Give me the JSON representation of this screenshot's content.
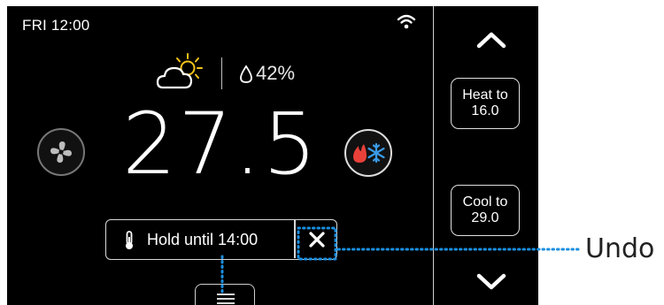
{
  "status": {
    "day_time": "FRI  12:00",
    "wifi_icon": "wifi-icon"
  },
  "weather": {
    "icon": "partly-sunny-icon",
    "humidity_icon": "droplet-icon",
    "humidity": "42%"
  },
  "current_temp": "27.5",
  "fan_button_icon": "fan-icon",
  "mode_button_icon": "heat-cool-mode-icon",
  "hold": {
    "icon": "thermometer-icon",
    "label": "Hold until 14:00",
    "close_icon": "close-icon"
  },
  "bottom_tab_icon": "menu-icon",
  "setpoints": {
    "up_icon": "chevron-up-icon",
    "heat": {
      "line1": "Heat to",
      "line2": "16.0"
    },
    "cool": {
      "line1": "Cool to",
      "line2": "29.0"
    },
    "down_icon": "chevron-down-icon"
  },
  "callout": {
    "label": "Undo",
    "color": "#1a8fe0"
  },
  "colors": {
    "flame": "#e8413a",
    "snowflake": "#3a9be8",
    "screen_bg": "#000000"
  }
}
